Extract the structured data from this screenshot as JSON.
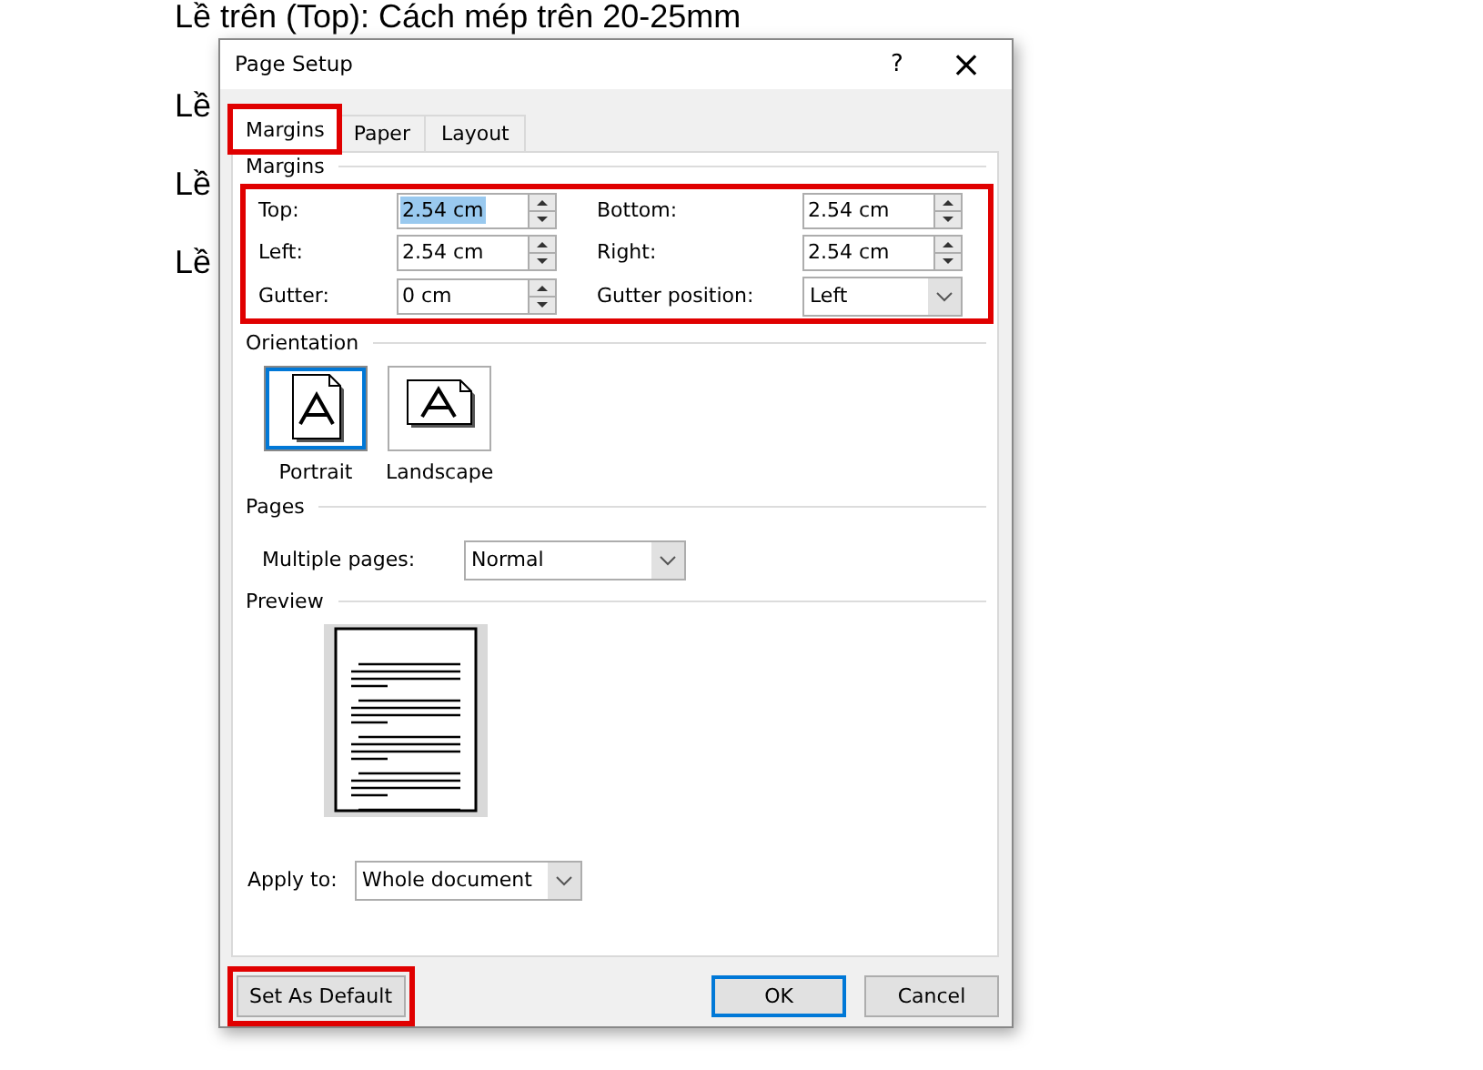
{
  "document": {
    "lines": [
      "Lề trên (Top): Cách mép trên 20-25mm",
      "Lề",
      "Lề",
      "Lề"
    ]
  },
  "dialog": {
    "title": "Page Setup",
    "help": "?",
    "close": "×"
  },
  "tabs": [
    {
      "label": "Margins",
      "selected": true,
      "highlighted": true
    },
    {
      "label": "Paper",
      "selected": false,
      "highlighted": false
    },
    {
      "label": "Layout",
      "selected": false,
      "highlighted": false
    }
  ],
  "margins": {
    "title": "Margins",
    "highlighted": true,
    "fields": [
      {
        "label": "Top:",
        "value": "2.54 cm",
        "kind": "spin",
        "text_selected": true
      },
      {
        "label": "Bottom:",
        "value": "2.54 cm",
        "kind": "spin",
        "text_selected": false
      },
      {
        "label": "Left:",
        "value": "2.54 cm",
        "kind": "spin",
        "text_selected": false
      },
      {
        "label": "Right:",
        "value": "2.54 cm",
        "kind": "spin",
        "text_selected": false
      },
      {
        "label": "Gutter:",
        "value": "0 cm",
        "kind": "spin",
        "text_selected": false
      },
      {
        "label": "Gutter position:",
        "value": "Left",
        "kind": "dropdown"
      }
    ]
  },
  "orientation": {
    "title": "Orientation",
    "options": [
      {
        "label": "Portrait",
        "selected": true,
        "kind": "portrait"
      },
      {
        "label": "Landscape",
        "selected": false,
        "kind": "landscape"
      }
    ]
  },
  "pages": {
    "title": "Pages",
    "label": "Multiple pages:",
    "value": "Normal"
  },
  "preview": {
    "title": "Preview"
  },
  "apply_to": {
    "label": "Apply to:",
    "value": "Whole document"
  },
  "buttons": [
    {
      "label": "Set As Default",
      "default": false,
      "highlighted": true
    },
    {
      "label": "OK",
      "default": true,
      "highlighted": false
    },
    {
      "label": "Cancel",
      "default": false,
      "highlighted": false
    }
  ]
}
